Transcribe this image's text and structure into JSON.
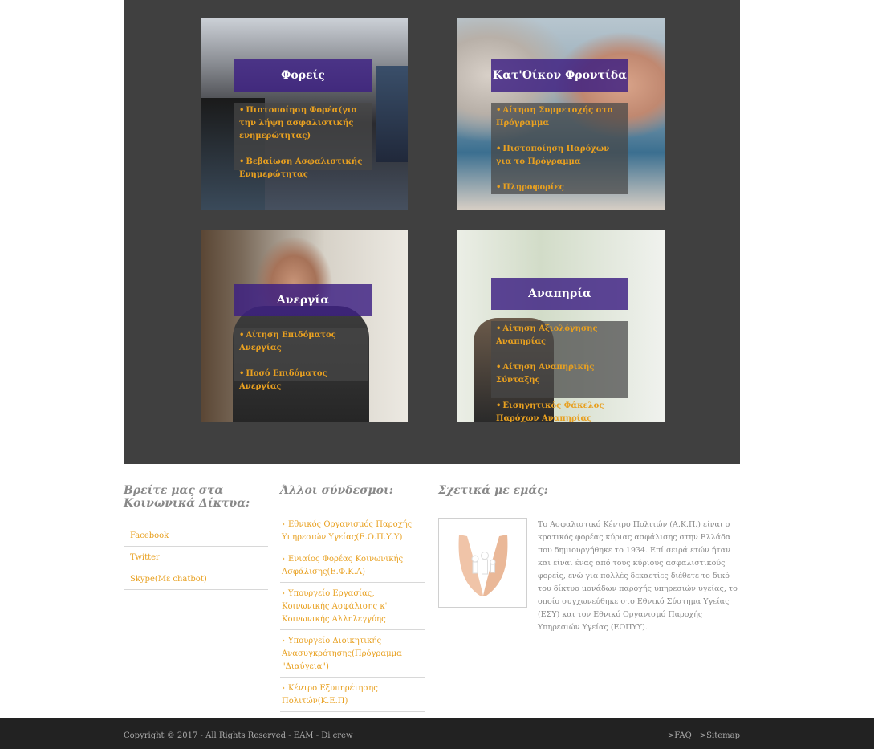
{
  "cards": [
    {
      "title": "Φορείς",
      "links": [
        "Πιστοποίηση Φορέα(για την λήψη ασφαλιστικής ενημερώτητας)",
        "Βεβαίωση Ασφαλιστικής Ενημερώτητας"
      ]
    },
    {
      "title": "Κατ'Οίκον Φροντίδα",
      "links": [
        "Αίτηση Συμμετοχής στο Πρόγραμμα",
        "Πιστοποίηση Παρόχων για το Πρόγραμμα",
        "Πληροφορίες"
      ]
    },
    {
      "title": "Ανεργία",
      "links": [
        "Αίτηση Επιδόματος Ανεργίας",
        "Ποσό Επιδόματος Ανεργίας"
      ]
    },
    {
      "title": "Αναπηρία",
      "links": [
        "Αίτηση Αξιολόγησης Αναπηρίας",
        "Αίτηση Αναπηρικής Σύνταξης",
        "Εισηγητικός Φάκελος Παρόχων Αναπηρίας"
      ]
    }
  ],
  "social": {
    "title": "Βρείτε μας στα Κοινωνικά Δίκτυα:",
    "items": [
      "Facebook",
      "Twitter",
      "Skype(Με chatbot)"
    ]
  },
  "other_links": {
    "title": "Άλλοι σύνδεσμοι:",
    "items": [
      "Εθνικός Οργανισμός Παροχής Υπηρεσιών Υγείας(Ε.Ο.Π.Υ.Υ)",
      "Ενιαίος Φορέας Κοινωνικής Ασφάλισης(Ε.Φ.Κ.Α)",
      "Υπουργείο Εργασίας, Κοινωνικής Ασφάλισης κ' Κοινωνικής Αλληλεγγύης",
      "Υπουργείο Διοικητικής Ανασυγκρότησης(Πρόγραμμα \"Διαύγεια\")",
      "Κέντρο Εξυπηρέτησης Πολιτών(Κ.Ε.Π)"
    ]
  },
  "about": {
    "title": "Σχετικά με εμάς:",
    "text": "Το Ασφαλιστικό Κέντρο Πολιτών (Α.Κ.Π.) είναι ο κρατικός φορέας κύριας ασφάλισης στην Ελλάδα που δημιουργήθηκε το 1934. Επί σειρά ετών ήταν και είναι ένας από τους κύριους ασφαλιστικούς φορείς, ενώ για πολλές δεκαετίες διέθετε το δικό του δίκτυο μονάδων παροχής υπηρεσιών υγείας, το οποίο συγχωνεύθηκε στο Εθνικό Σύστημα Υγείας (ΕΣΥ) και τον Εθνικό Οργανισμό Παροχής Υπηρεσιών Υγείας (ΕΟΠΥΥ)."
  },
  "footer": {
    "copyright": "Copyright © 2017 - All Rights Reserved - ΕΑΜ - Di crew",
    "links": [
      ">FAQ",
      ">Sitemap"
    ]
  },
  "colors": {
    "panel": "#404040",
    "title_box": "#3c1e82",
    "link": "#e8a020",
    "bottom_bar": "#222222"
  }
}
